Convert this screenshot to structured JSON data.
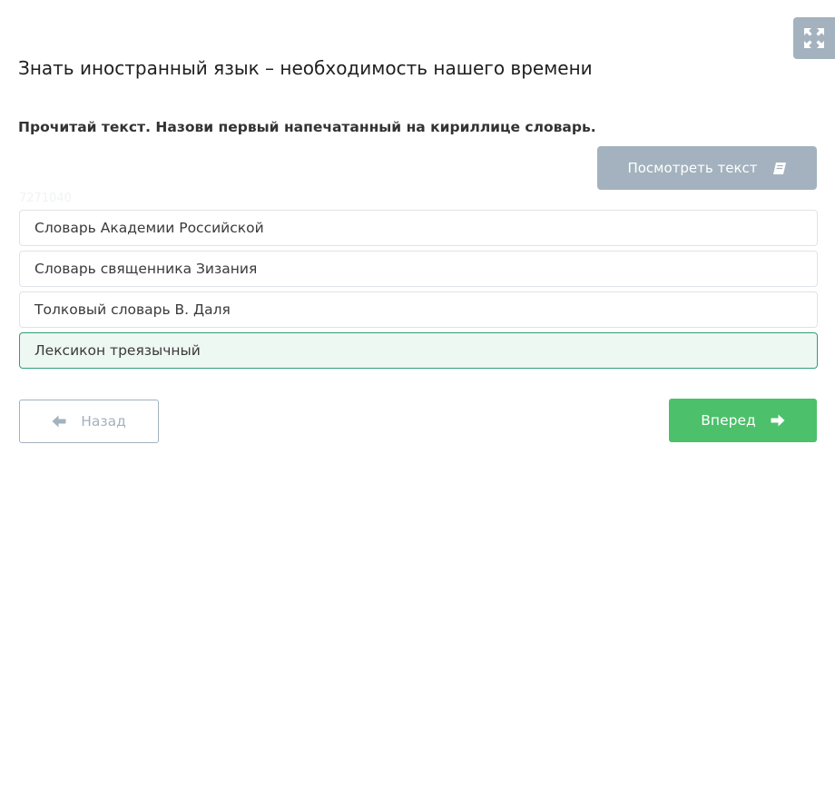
{
  "header": {
    "fullscreen_icon": "expand-arrows-icon"
  },
  "title": "Знать иностранный язык – необходимость нашего времени",
  "question": "Прочитай текст. Назови первый напечатанный на кириллице словарь.",
  "view_text_button": {
    "label": "Посмотреть текст",
    "icon": "book-icon"
  },
  "task_id": "7271040",
  "options": [
    {
      "label": "Словарь Академии Российской",
      "selected": false
    },
    {
      "label": "Словарь священника Зизания",
      "selected": false
    },
    {
      "label": "Толковый словарь В. Даля",
      "selected": false
    },
    {
      "label": "Лексикон треязычный",
      "selected": true
    }
  ],
  "navigation": {
    "back_label": "Назад",
    "back_icon": "arrow-left-icon",
    "next_label": "Вперед",
    "next_icon": "arrow-right-icon"
  },
  "colors": {
    "gray_button": "#a3b2be",
    "next_button": "#4cc06a",
    "selected_border": "#2f9e75",
    "selected_background": "#eef8f3"
  }
}
